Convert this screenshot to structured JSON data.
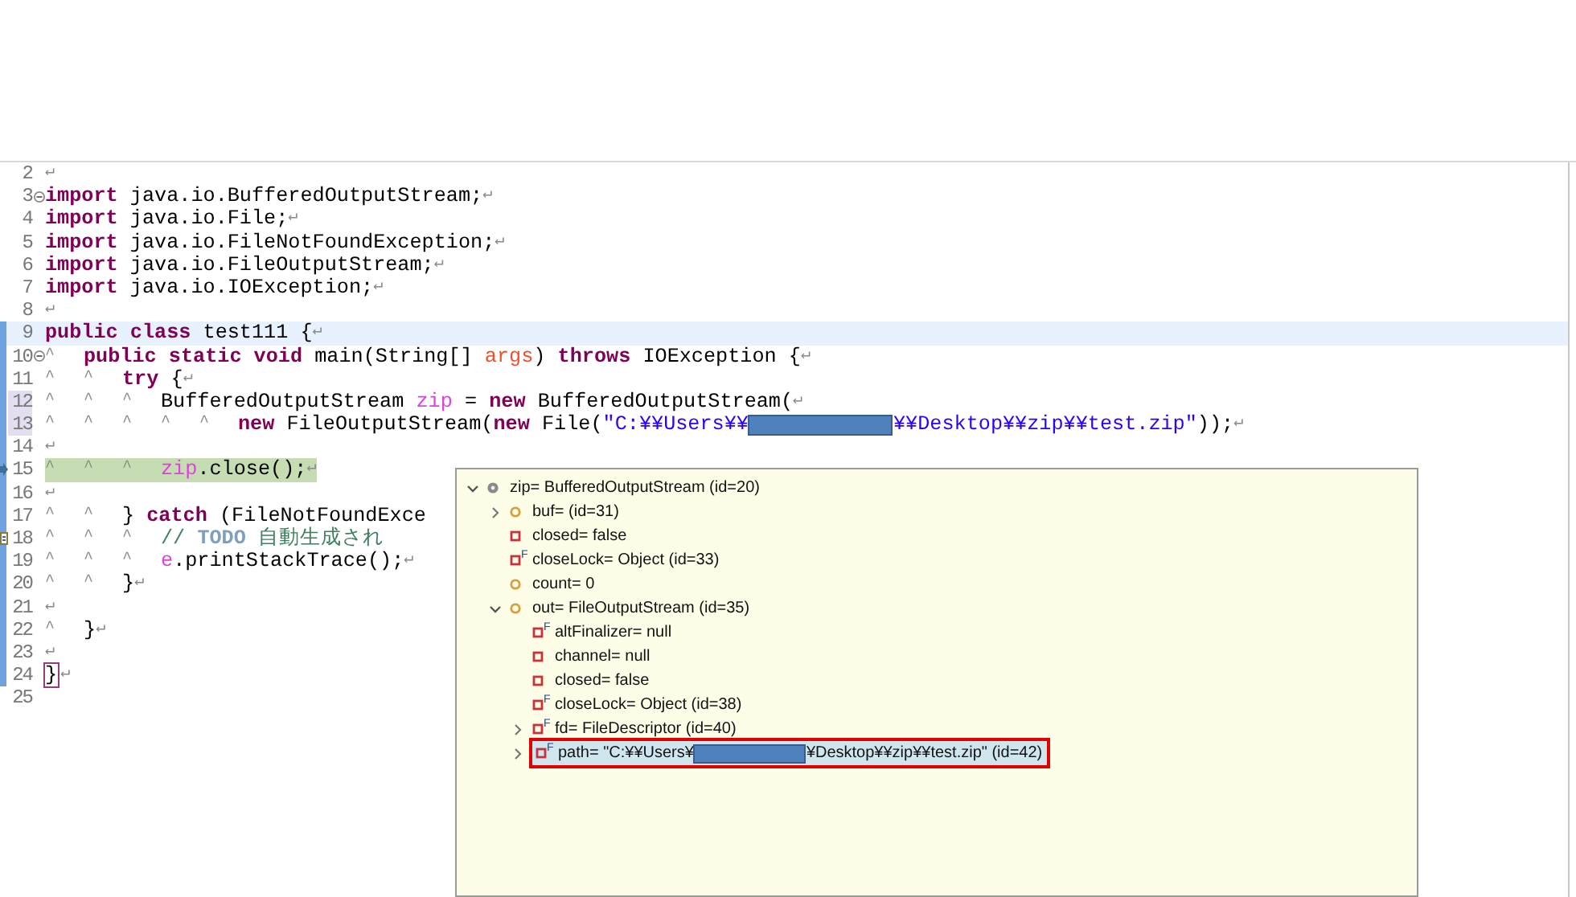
{
  "editor": {
    "lines": [
      {
        "number": "2",
        "tokens": [
          {
            "kind": "eol",
            "text": "↵"
          }
        ]
      },
      {
        "number": "3",
        "fold": true,
        "tokens": [
          {
            "kind": "kw",
            "text": "import"
          },
          {
            "kind": "plain",
            "text": " java.io.BufferedOutputStream;"
          },
          {
            "kind": "eol",
            "text": "↵"
          }
        ]
      },
      {
        "number": "4",
        "tokens": [
          {
            "kind": "kw",
            "text": "import"
          },
          {
            "kind": "plain",
            "text": " java.io.File;"
          },
          {
            "kind": "eol",
            "text": "↵"
          }
        ]
      },
      {
        "number": "5",
        "tokens": [
          {
            "kind": "kw",
            "text": "import"
          },
          {
            "kind": "plain",
            "text": " java.io.FileNotFoundException;"
          },
          {
            "kind": "eol",
            "text": "↵"
          }
        ]
      },
      {
        "number": "6",
        "tokens": [
          {
            "kind": "kw",
            "text": "import"
          },
          {
            "kind": "plain",
            "text": " java.io.FileOutputStream;"
          },
          {
            "kind": "eol",
            "text": "↵"
          }
        ]
      },
      {
        "number": "7",
        "tokens": [
          {
            "kind": "kw",
            "text": "import"
          },
          {
            "kind": "plain",
            "text": " java.io.IOException;"
          },
          {
            "kind": "eol",
            "text": "↵"
          }
        ]
      },
      {
        "number": "8",
        "tokens": [
          {
            "kind": "eol",
            "text": "↵"
          }
        ]
      },
      {
        "number": "9",
        "current": true,
        "changed": true,
        "tokens": [
          {
            "kind": "kw",
            "text": "public class"
          },
          {
            "kind": "plain",
            "text": " test111 {"
          },
          {
            "kind": "eol",
            "text": "↵"
          }
        ]
      },
      {
        "number": "10",
        "fold": true,
        "changed": true,
        "tokens": [
          {
            "kind": "tab",
            "text": "^"
          },
          {
            "kind": "kw",
            "text": "public static void"
          },
          {
            "kind": "plain",
            "text": " main(String[] "
          },
          {
            "kind": "param",
            "text": "args"
          },
          {
            "kind": "plain",
            "text": ") "
          },
          {
            "kind": "kw",
            "text": "throws"
          },
          {
            "kind": "plain",
            "text": " IOException {"
          },
          {
            "kind": "eol",
            "text": "↵"
          }
        ]
      },
      {
        "number": "11",
        "changed": true,
        "tokens": [
          {
            "kind": "tab",
            "text": "^"
          },
          {
            "kind": "tab",
            "text": "^"
          },
          {
            "kind": "kw",
            "text": "try"
          },
          {
            "kind": "plain",
            "text": " {"
          },
          {
            "kind": "eol",
            "text": "↵"
          }
        ]
      },
      {
        "number": "12",
        "marked": true,
        "changed": true,
        "tokens": [
          {
            "kind": "tab",
            "text": "^"
          },
          {
            "kind": "tab",
            "text": "^"
          },
          {
            "kind": "tab",
            "text": "^"
          },
          {
            "kind": "plain",
            "text": "BufferedOutputStream "
          },
          {
            "kind": "var",
            "text": "zip"
          },
          {
            "kind": "plain",
            "text": " = "
          },
          {
            "kind": "kw",
            "text": "new"
          },
          {
            "kind": "plain",
            "text": " BufferedOutputStream("
          },
          {
            "kind": "eol",
            "text": "↵"
          }
        ]
      },
      {
        "number": "13",
        "marked": true,
        "changed": true,
        "tokens": [
          {
            "kind": "tab",
            "text": "^"
          },
          {
            "kind": "tab",
            "text": "^"
          },
          {
            "kind": "tab",
            "text": "^"
          },
          {
            "kind": "tab",
            "text": "^"
          },
          {
            "kind": "tab",
            "text": "^"
          },
          {
            "kind": "kw",
            "text": "new"
          },
          {
            "kind": "plain",
            "text": " FileOutputStream("
          },
          {
            "kind": "kw",
            "text": "new"
          },
          {
            "kind": "plain",
            "text": " File("
          },
          {
            "kind": "str",
            "text": "\"C:¥¥Users¥¥"
          },
          {
            "kind": "redact"
          },
          {
            "kind": "str",
            "text": "¥¥Desktop¥¥zip¥¥test.zip\""
          },
          {
            "kind": "plain",
            "text": "));"
          },
          {
            "kind": "eol",
            "text": "↵"
          }
        ]
      },
      {
        "number": "14",
        "changed": true,
        "tokens": [
          {
            "kind": "eol",
            "text": "↵"
          }
        ]
      },
      {
        "number": "15",
        "debug": true,
        "instruction_pointer": true,
        "changed": true,
        "tokens": [
          {
            "kind": "tab",
            "text": "^"
          },
          {
            "kind": "tab",
            "text": "^"
          },
          {
            "kind": "tab",
            "text": "^"
          },
          {
            "kind": "var",
            "text": "zip"
          },
          {
            "kind": "plain",
            "text": ".close();"
          },
          {
            "kind": "eol",
            "text": "↵"
          }
        ]
      },
      {
        "number": "16",
        "changed": true,
        "tokens": [
          {
            "kind": "eol",
            "text": "↵"
          }
        ]
      },
      {
        "number": "17",
        "changed": true,
        "tokens": [
          {
            "kind": "tab",
            "text": "^"
          },
          {
            "kind": "tab",
            "text": "^"
          },
          {
            "kind": "plain",
            "text": "} "
          },
          {
            "kind": "kw",
            "text": "catch"
          },
          {
            "kind": "plain",
            "text": " (FileNotFoundExce"
          }
        ]
      },
      {
        "number": "18",
        "task": true,
        "changed": true,
        "tokens": [
          {
            "kind": "tab",
            "text": "^"
          },
          {
            "kind": "tab",
            "text": "^"
          },
          {
            "kind": "tab",
            "text": "^"
          },
          {
            "kind": "cmt",
            "text": "// "
          },
          {
            "kind": "todo",
            "text": "TODO"
          },
          {
            "kind": "cmt",
            "text": " 自動生成され"
          }
        ]
      },
      {
        "number": "19",
        "changed": true,
        "tokens": [
          {
            "kind": "tab",
            "text": "^"
          },
          {
            "kind": "tab",
            "text": "^"
          },
          {
            "kind": "tab",
            "text": "^"
          },
          {
            "kind": "var",
            "text": "e"
          },
          {
            "kind": "plain",
            "text": ".printStackTrace();"
          },
          {
            "kind": "eol",
            "text": "↵"
          }
        ]
      },
      {
        "number": "20",
        "changed": true,
        "tokens": [
          {
            "kind": "tab",
            "text": "^"
          },
          {
            "kind": "tab",
            "text": "^"
          },
          {
            "kind": "plain",
            "text": "}"
          },
          {
            "kind": "eol",
            "text": "↵"
          }
        ]
      },
      {
        "number": "21",
        "changed": true,
        "tokens": [
          {
            "kind": "eol",
            "text": "↵"
          }
        ]
      },
      {
        "number": "22",
        "changed": true,
        "tokens": [
          {
            "kind": "tab",
            "text": "^"
          },
          {
            "kind": "plain",
            "text": "}"
          },
          {
            "kind": "eol",
            "text": "↵"
          }
        ]
      },
      {
        "number": "23",
        "changed": true,
        "tokens": [
          {
            "kind": "eol",
            "text": "↵"
          }
        ]
      },
      {
        "number": "24",
        "changed": true,
        "tokens": [
          {
            "kind": "match",
            "text": "}"
          },
          {
            "kind": "eol",
            "text": "↵"
          }
        ]
      },
      {
        "number": "25"
      }
    ]
  },
  "variables_popup": {
    "nodes": [
      {
        "kind": "local",
        "label": "zip= BufferedOutputStream  (id=20)",
        "expanded": true,
        "children": [
          {
            "kind": "default",
            "label": "buf= (id=31)",
            "expanded": false
          },
          {
            "kind": "private",
            "label": "closed= false"
          },
          {
            "kind": "private",
            "modifier": "F",
            "label": "closeLock= Object  (id=33)"
          },
          {
            "kind": "default",
            "label": "count= 0"
          },
          {
            "kind": "default",
            "label": "out= FileOutputStream  (id=35)",
            "expanded": true,
            "children": [
              {
                "kind": "private",
                "modifier": "F",
                "label": "altFinalizer= null"
              },
              {
                "kind": "private",
                "label": "channel= null"
              },
              {
                "kind": "private",
                "label": "closed= false"
              },
              {
                "kind": "private",
                "modifier": "F",
                "label": "closeLock= Object  (id=38)"
              },
              {
                "kind": "private",
                "modifier": "F",
                "label": "fd= FileDescriptor  (id=40)",
                "expanded": false
              },
              {
                "kind": "private",
                "modifier": "F",
                "label": "path= \"C:¥¥Users¥",
                "redacted": true,
                "label_after": "¥Desktop¥¥zip¥¥test.zip\" (id=42)",
                "expanded": false,
                "selected": true,
                "highlighted": true
              }
            ]
          }
        ]
      }
    ]
  }
}
